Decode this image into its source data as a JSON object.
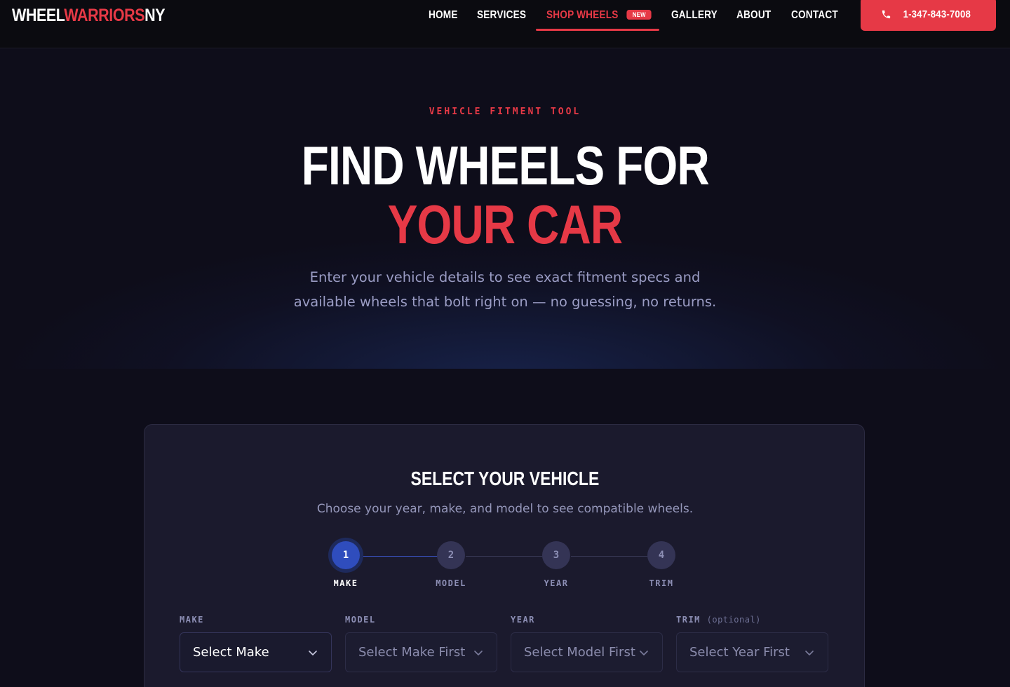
{
  "nav": {
    "logo": {
      "part1": "WHEEL",
      "part2": "WARRIORS",
      "part3": "NY"
    },
    "links": [
      {
        "label": "HOME"
      },
      {
        "label": "SERVICES"
      },
      {
        "label": "SHOP WHEELS",
        "badge": "NEW"
      },
      {
        "label": "GALLERY"
      },
      {
        "label": "ABOUT"
      },
      {
        "label": "CONTACT"
      }
    ],
    "active_link": "SHOP WHEELS",
    "phone": "1-347-843-7008"
  },
  "hero": {
    "eyebrow": "VEHICLE FITMENT TOOL",
    "headline_line1": "FIND WHEELS FOR",
    "headline_line2": "YOUR CAR",
    "subtitle": "Enter your vehicle details to see exact fitment specs and available wheels that bolt right on — no guessing, no returns."
  },
  "selector": {
    "title": "SELECT YOUR VEHICLE",
    "subtitle": "Choose your year, make, and model to see compatible wheels.",
    "steps": [
      {
        "number": "1",
        "label": "MAKE",
        "active": true
      },
      {
        "number": "2",
        "label": "MODEL",
        "active": false
      },
      {
        "number": "3",
        "label": "YEAR",
        "active": false
      },
      {
        "number": "4",
        "label": "TRIM",
        "active": false
      }
    ],
    "fields": [
      {
        "label": "MAKE",
        "optional_note": "",
        "value": "Select Make",
        "enabled": true
      },
      {
        "label": "MODEL",
        "optional_note": "",
        "value": "Select Make First",
        "enabled": false
      },
      {
        "label": "YEAR",
        "optional_note": "",
        "value": "Select Model First",
        "enabled": false
      },
      {
        "label": "TRIM",
        "optional_note": "(optional)",
        "value": "Select Year First",
        "enabled": false
      }
    ]
  },
  "colors": {
    "accent": "#e63946",
    "active_step": "#2f4dbd",
    "background": "#0e0d1a",
    "card": "#1b1a2d"
  }
}
